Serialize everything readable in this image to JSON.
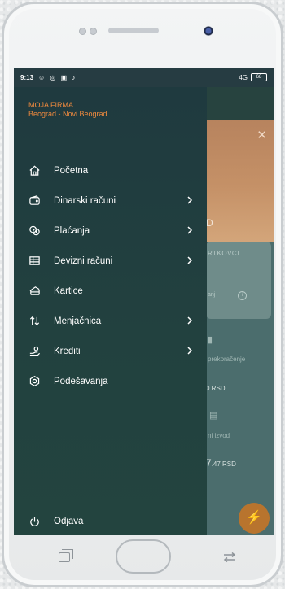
{
  "status_bar": {
    "time": "9:13",
    "icons": "☺ ◎ ▣ ♪",
    "signal": "4G",
    "battery": "68"
  },
  "drawer": {
    "company_name": "MOJA FIRMA",
    "company_location": "Beograd - Novi Beograd",
    "items": [
      {
        "label": "Početna",
        "icon": "home-icon",
        "has_submenu": false
      },
      {
        "label": "Dinarski računi",
        "icon": "wallet-icon",
        "has_submenu": true
      },
      {
        "label": "Plaćanja",
        "icon": "payments-icon",
        "has_submenu": true
      },
      {
        "label": "Devizni računi",
        "icon": "foreign-accounts-icon",
        "has_submenu": true
      },
      {
        "label": "Kartice",
        "icon": "card-icon",
        "has_submenu": false
      },
      {
        "label": "Menjačnica",
        "icon": "exchange-icon",
        "has_submenu": true
      },
      {
        "label": "Krediti",
        "icon": "loan-icon",
        "has_submenu": true
      },
      {
        "label": "Podešavanja",
        "icon": "settings-icon",
        "has_submenu": false
      }
    ],
    "logout_label": "Odjava"
  },
  "background_app": {
    "card_title": "RTKOVCI",
    "card_sub": "anj",
    "label_overdraft": "prekoračenje",
    "amount_1": "0 RSD",
    "label_credit": "ni izvod",
    "amount_2_main": "7",
    "amount_2_rest": ".47 RSD",
    "hero_value": "D"
  },
  "colors": {
    "accent": "#f08a3e",
    "drawer_bg": "#1f3a3f",
    "fab": "#b8742e"
  }
}
